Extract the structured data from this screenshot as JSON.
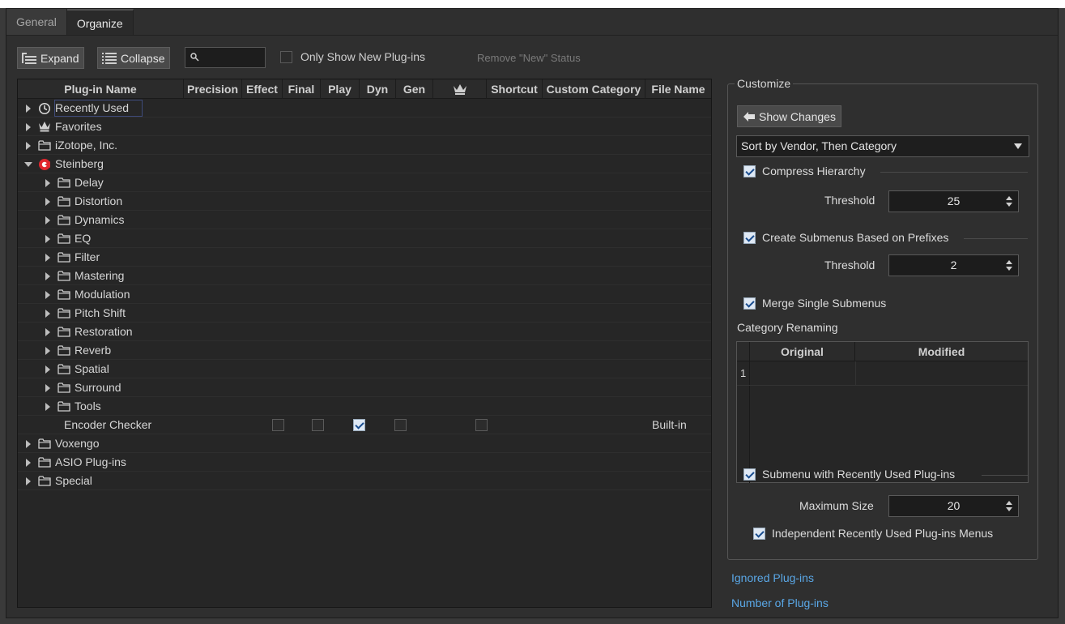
{
  "tabs": [
    "General",
    "Organize"
  ],
  "toolbar": {
    "expand_label": "Expand",
    "collapse_label": "Collapse",
    "search_value": "",
    "only_new_label": "Only Show New Plug-ins",
    "remove_new_label": "Remove \"New\" Status"
  },
  "table": {
    "columns": [
      "Plug-in Name",
      "Precision",
      "Effect",
      "Final",
      "Play",
      "Dyn",
      "Gen",
      "crown",
      "Shortcut",
      "Custom Category",
      "File Name"
    ],
    "rows": [
      {
        "label": "Recently Used",
        "icon": "clock-icon",
        "level": 0,
        "expand": "right"
      },
      {
        "label": "Favorites",
        "icon": "crown-icon",
        "level": 0,
        "expand": "right"
      },
      {
        "label": "iZotope, Inc.",
        "icon": "folder-icon",
        "level": 0,
        "expand": "right"
      },
      {
        "label": "Steinberg",
        "icon": "steinberg-icon",
        "level": 0,
        "expand": "down"
      },
      {
        "label": "Delay",
        "icon": "folder-icon",
        "level": 1,
        "expand": "right"
      },
      {
        "label": "Distortion",
        "icon": "folder-icon",
        "level": 1,
        "expand": "right"
      },
      {
        "label": "Dynamics",
        "icon": "folder-icon",
        "level": 1,
        "expand": "right"
      },
      {
        "label": "EQ",
        "icon": "folder-icon",
        "level": 1,
        "expand": "right"
      },
      {
        "label": "Filter",
        "icon": "folder-icon",
        "level": 1,
        "expand": "right"
      },
      {
        "label": "Mastering",
        "icon": "folder-icon",
        "level": 1,
        "expand": "right"
      },
      {
        "label": "Modulation",
        "icon": "folder-icon",
        "level": 1,
        "expand": "right"
      },
      {
        "label": "Pitch Shift",
        "icon": "folder-icon",
        "level": 1,
        "expand": "right"
      },
      {
        "label": "Restoration",
        "icon": "folder-icon",
        "level": 1,
        "expand": "right"
      },
      {
        "label": "Reverb",
        "icon": "folder-icon",
        "level": 1,
        "expand": "right"
      },
      {
        "label": "Spatial",
        "icon": "folder-icon",
        "level": 1,
        "expand": "right"
      },
      {
        "label": "Surround",
        "icon": "folder-icon",
        "level": 1,
        "expand": "right"
      },
      {
        "label": "Tools",
        "icon": "folder-icon",
        "level": 1,
        "expand": "right"
      },
      {
        "label": "Encoder Checker",
        "icon": "",
        "level": 2,
        "expand": "",
        "checks": {
          "Final": false,
          "Play": false,
          "Dyn": true,
          "Gen": false,
          "crown": false
        },
        "file_name": "Built-in"
      },
      {
        "label": "Voxengo",
        "icon": "folder-icon",
        "level": 0,
        "expand": "right"
      },
      {
        "label": "ASIO Plug-ins",
        "icon": "folder-icon",
        "level": 0,
        "expand": "right"
      },
      {
        "label": "Special",
        "icon": "folder-icon",
        "level": 0,
        "expand": "right"
      }
    ]
  },
  "customize": {
    "title": "Customize",
    "show_changes_label": "Show Changes",
    "sort_value": "Sort by Vendor, Then Category",
    "compress_label": "Compress Hierarchy",
    "compress_checked": true,
    "threshold_label": "Threshold",
    "compress_threshold": "25",
    "submenus_label": "Create Submenus Based on Prefixes",
    "submenus_checked": true,
    "submenus_threshold": "2",
    "merge_label": "Merge Single Submenus",
    "merge_checked": true,
    "renaming_label": "Category Renaming",
    "renaming_columns": [
      "Original",
      "Modified"
    ],
    "renaming_row_num": "1",
    "recent_label": "Submenu with Recently Used Plug-ins",
    "recent_checked": true,
    "max_size_label": "Maximum Size",
    "max_size_value": "20",
    "independent_label": "Independent Recently Used Plug-ins Menus",
    "independent_checked": true
  },
  "links": {
    "ignored": "Ignored Plug-ins",
    "count": "Number of Plug-ins"
  },
  "colors": {
    "accent_link": "#5aa7e6",
    "steinberg_red": "#e0262e"
  }
}
